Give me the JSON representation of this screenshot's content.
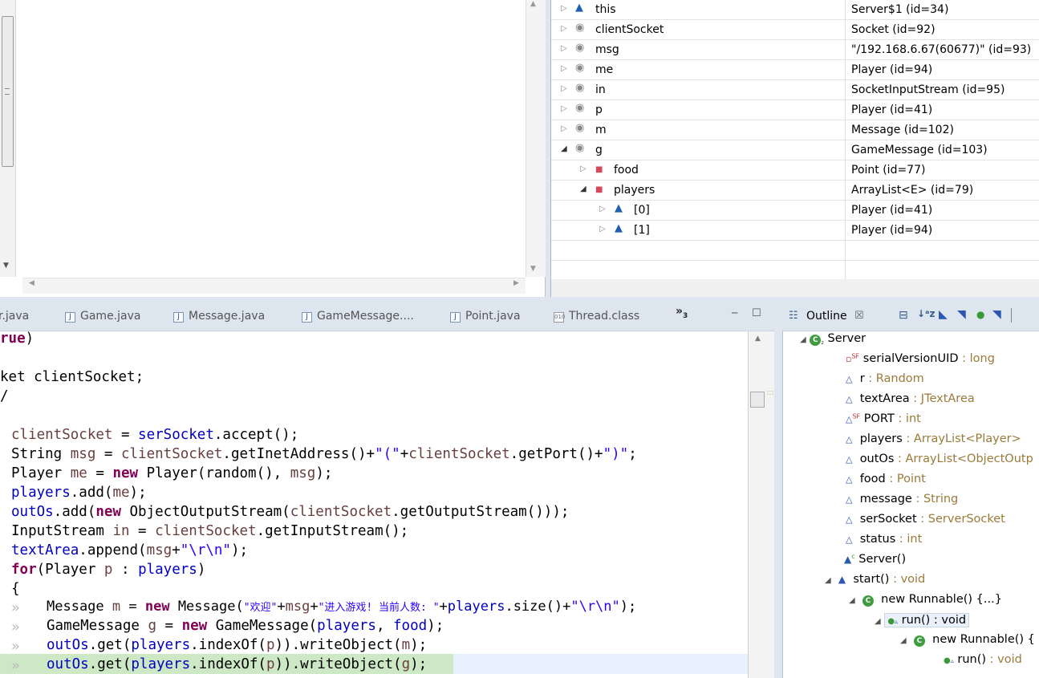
{
  "variables": {
    "rows": [
      {
        "twisty": "▷",
        "icon": "▲",
        "name": "this",
        "value": "Server$1  (id=34)"
      },
      {
        "twisty": "▷",
        "icon": "◉",
        "name": "clientSocket",
        "value": "Socket  (id=92)"
      },
      {
        "twisty": "▷",
        "icon": "◉",
        "name": "msg",
        "value": "\"/192.168.6.67(60677)\" (id=93)"
      },
      {
        "twisty": "▷",
        "icon": "◉",
        "name": "me",
        "value": "Player  (id=94)"
      },
      {
        "twisty": "▷",
        "icon": "◉",
        "name": "in",
        "value": "SocketInputStream  (id=95)"
      },
      {
        "twisty": "▷",
        "icon": "◉",
        "name": "p",
        "value": "Player  (id=41)"
      },
      {
        "twisty": "▷",
        "icon": "◉",
        "name": "m",
        "value": "Message  (id=102)"
      },
      {
        "twisty": "◢",
        "icon": "◉",
        "name": "g",
        "value": "GameMessage  (id=103)"
      },
      {
        "twisty": "▷",
        "icon": "■",
        "name": "food",
        "value": "Point  (id=77)"
      },
      {
        "twisty": "◢",
        "icon": "■",
        "name": "players",
        "value": "ArrayList<E>  (id=79)"
      },
      {
        "twisty": "▷",
        "icon": "▲",
        "name": "[0]",
        "value": "Player  (id=41)"
      },
      {
        "twisty": "▷",
        "icon": "▲",
        "name": "[1]",
        "value": "Player  (id=94)"
      }
    ]
  },
  "tabs": {
    "t0": "r.java",
    "t1": "Game.java",
    "t2": "Message.java",
    "t3": "GameMessage....",
    "t4": "Point.java",
    "t5": "Thread.class",
    "overflow": "»",
    "overflow_count": "3",
    "minimize": "─",
    "maximize": "☐"
  },
  "editor": {
    "l1_rest": ")",
    "l1_kw": "rue",
    "l2": "ket clientSocket;",
    "l3": "/",
    "c1_var": "clientSocket",
    "c1_mid": " = ",
    "c1_fld": "serSocket",
    "c1_end": ".accept();",
    "c2_a": "String ",
    "c2_var": "msg",
    "c2_b": " = ",
    "c2_var2": "clientSocket",
    "c2_c": ".getInetAddress()+",
    "c2_str": "\"(\"",
    "c2_d": "+",
    "c2_var3": "clientSocket",
    "c2_e": ".getPort()+",
    "c2_str2": "\")\"",
    "c2_f": ";",
    "c3_a": "Player ",
    "c3_var": "me",
    "c3_b": " = ",
    "c3_kw": "new",
    "c3_c": " Player(random(), ",
    "c3_var2": "msg",
    "c3_d": ");",
    "c4_fld": "players",
    "c4_a": ".add(",
    "c4_var": "me",
    "c4_b": ");",
    "c5_fld": "outOs",
    "c5_a": ".add(",
    "c5_kw": "new",
    "c5_b": " ObjectOutputStream(",
    "c5_var": "clientSocket",
    "c5_c": ".getOutputStream()));",
    "c6_a": "InputStream ",
    "c6_var": "in",
    "c6_b": " = ",
    "c6_var2": "clientSocket",
    "c6_c": ".getInputStream();",
    "c7_fld": "textArea",
    "c7_a": ".append(",
    "c7_var": "msg",
    "c7_b": "+",
    "c7_str": "\"\\r\\n\"",
    "c7_c": ");",
    "c8_kw": "for",
    "c8_a": "(Player ",
    "c8_var": "p",
    "c8_b": " : ",
    "c8_fld": "players",
    "c8_c": ")",
    "c9": "{",
    "ws": "»",
    "c10_a": "Message ",
    "c10_var": "m",
    "c10_b": " = ",
    "c10_kw": "new",
    "c10_c": " Message(",
    "c10_str": "\"欢迎\"",
    "c10_d": "+",
    "c10_var2": "msg",
    "c10_e": "+",
    "c10_str2": "\"进入游戏! 当前人数: \"",
    "c10_f": "+",
    "c10_fld": "players",
    "c10_g": ".size()+",
    "c10_str3": "\"\\r\\n\"",
    "c10_h": ");",
    "c11_a": "GameMessage ",
    "c11_var": "g",
    "c11_b": " = ",
    "c11_kw": "new",
    "c11_c": " GameMessage(",
    "c11_fld": "players",
    "c11_d": ", ",
    "c11_fld2": "food",
    "c11_e": ");",
    "c12_fld": "outOs",
    "c12_a": ".get(",
    "c12_fld2": "players",
    "c12_b": ".indexOf(",
    "c12_var": "p",
    "c12_c": ")).writeObject(",
    "c12_var2": "m",
    "c12_d": ");",
    "c13_fld": "outOs",
    "c13_a": ".get(",
    "c13_fld2": "players",
    "c13_b": ".indexOf(",
    "c13_var": "p",
    "c13_c": ")).writeObject(",
    "c13_var2": "g",
    "c13_d": ");"
  },
  "outline": {
    "title": "Outline",
    "close": "☒",
    "rows": {
      "server": "Server",
      "serial_name": "serialVersionUID",
      "serial_type": " : long",
      "r_name": "r",
      "r_type": " : Random",
      "textarea_name": "textArea",
      "textarea_type": " : JTextArea",
      "port_name": "PORT",
      "port_type": " : int",
      "players_name": "players",
      "players_type": " : ArrayList<Player>",
      "outos_name": "outOs",
      "outos_type": " : ArrayList<ObjectOutp",
      "food_name": "food",
      "food_type": " : Point",
      "message_name": "message",
      "message_type": " : String",
      "sersocket_name": "serSocket",
      "sersocket_type": " : ServerSocket",
      "status_name": "status",
      "status_type": " : int",
      "ctor": "Server()",
      "start_name": "start()",
      "start_type": " : void",
      "runnable1": "new Runnable() {...}",
      "run1_name": "run()",
      "run1_type": " : void",
      "runnable2": "new Runnable() {",
      "run2_name": "run()",
      "run2_type": " : void"
    }
  },
  "colors": {
    "keyword": "#7f0055",
    "field": "#0000c0",
    "local": "#6a3e3e",
    "string": "#2a00ff",
    "current_line": "#cde8c5"
  }
}
